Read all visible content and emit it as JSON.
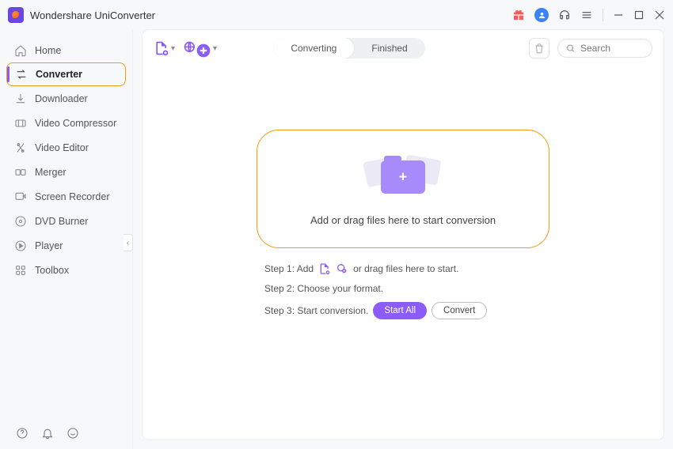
{
  "app": {
    "title": "Wondershare UniConverter"
  },
  "titlebar_icons": [
    "gift",
    "avatar",
    "support",
    "menu",
    "min",
    "max",
    "close"
  ],
  "sidebar": {
    "items": [
      {
        "label": "Home",
        "icon": "home"
      },
      {
        "label": "Converter",
        "icon": "converter",
        "active": true,
        "highlighted": true
      },
      {
        "label": "Downloader",
        "icon": "download"
      },
      {
        "label": "Video Compressor",
        "icon": "compress"
      },
      {
        "label": "Video Editor",
        "icon": "editor"
      },
      {
        "label": "Merger",
        "icon": "merger"
      },
      {
        "label": "Screen Recorder",
        "icon": "recorder"
      },
      {
        "label": "DVD Burner",
        "icon": "dvd"
      },
      {
        "label": "Player",
        "icon": "player"
      },
      {
        "label": "Toolbox",
        "icon": "toolbox"
      }
    ]
  },
  "tabs": {
    "converting": "Converting",
    "finished": "Finished",
    "active": "converting"
  },
  "search": {
    "placeholder": "Search"
  },
  "dropzone": {
    "text": "Add or drag files here to start conversion"
  },
  "steps": {
    "s1a": "Step 1: Add",
    "s1b": "or drag files here to start.",
    "s2": "Step 2: Choose your format.",
    "s3": "Step 3: Start conversion.",
    "start_all": "Start All",
    "convert": "Convert"
  },
  "colors": {
    "accent": "#8b5cf6",
    "highlight": "#f39c12"
  }
}
